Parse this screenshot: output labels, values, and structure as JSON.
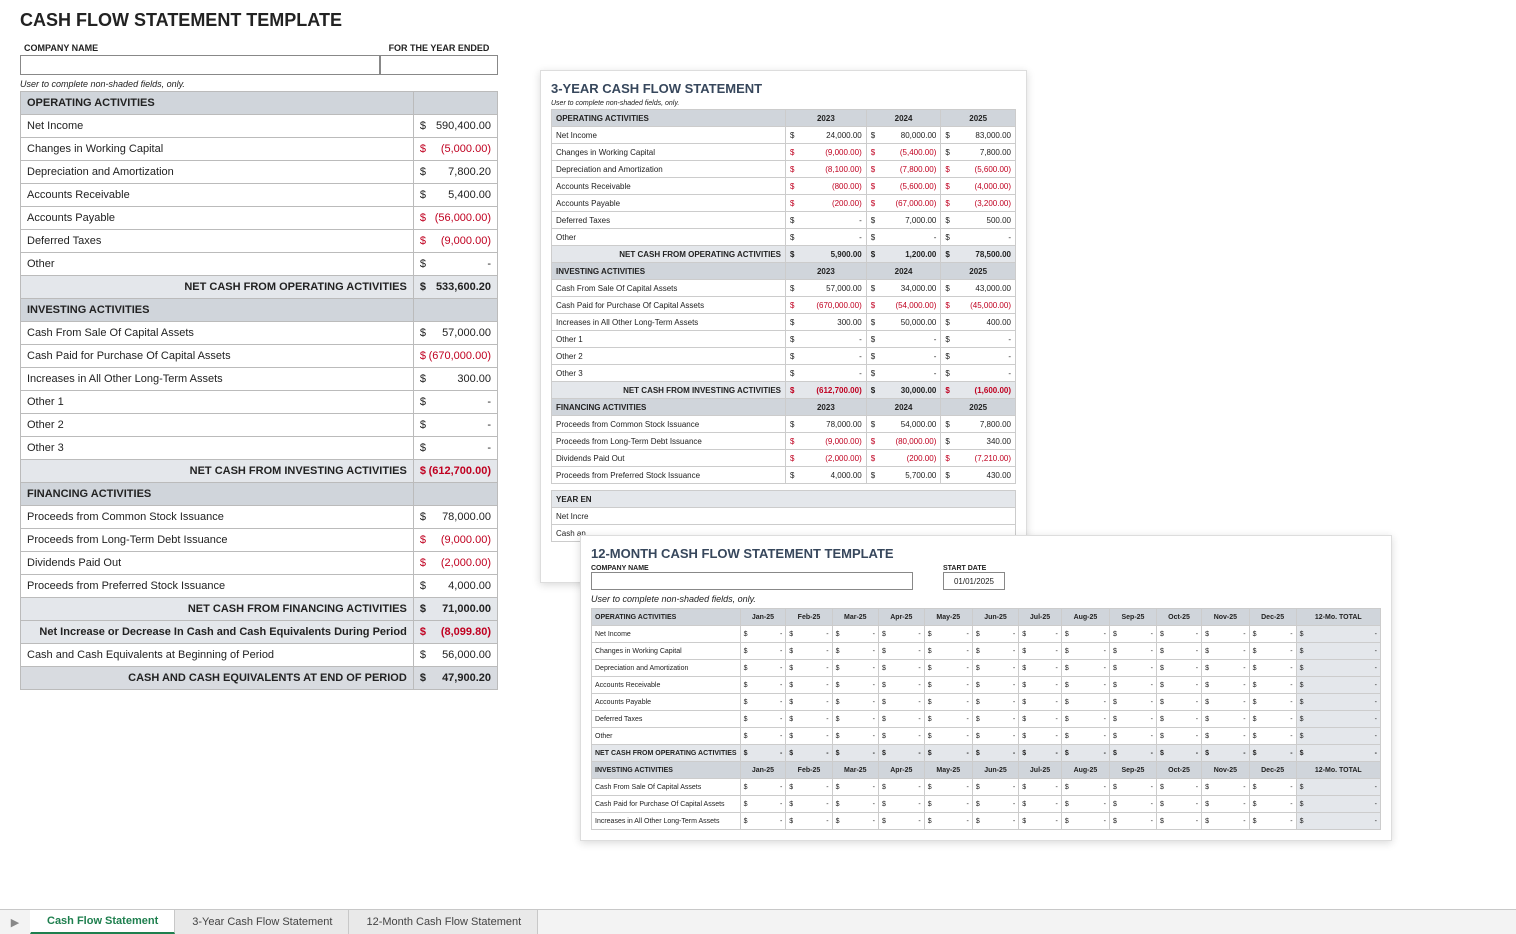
{
  "main": {
    "title": "CASH FLOW STATEMENT TEMPLATE",
    "label_company": "COMPANY NAME",
    "label_year": "FOR THE YEAR ENDED",
    "note": "User to complete non-shaded fields, only.",
    "sec_op": "OPERATING ACTIVITIES",
    "sec_inv": "INVESTING ACTIVITIES",
    "sec_fin": "FINANCING ACTIVITIES",
    "op_rows": [
      {
        "label": "Net Income",
        "val": "590,400.00",
        "neg": false
      },
      {
        "label": "Changes in Working Capital",
        "val": "(5,000.00)",
        "neg": true
      },
      {
        "label": "Depreciation and Amortization",
        "val": "7,800.20",
        "neg": false
      },
      {
        "label": "Accounts Receivable",
        "val": "5,400.00",
        "neg": false
      },
      {
        "label": "Accounts Payable",
        "val": "(56,000.00)",
        "neg": true
      },
      {
        "label": "Deferred Taxes",
        "val": "(9,000.00)",
        "neg": true
      },
      {
        "label": "Other",
        "val": "-",
        "neg": false
      }
    ],
    "op_total_label": "NET CASH FROM OPERATING ACTIVITIES",
    "op_total": "533,600.20",
    "inv_rows": [
      {
        "label": "Cash From Sale Of Capital Assets",
        "val": "57,000.00",
        "neg": false
      },
      {
        "label": "Cash Paid for Purchase Of Capital Assets",
        "val": "(670,000.00)",
        "neg": true
      },
      {
        "label": "Increases in All Other Long-Term Assets",
        "val": "300.00",
        "neg": false
      },
      {
        "label": "Other 1",
        "val": "-",
        "neg": false
      },
      {
        "label": "Other 2",
        "val": "-",
        "neg": false
      },
      {
        "label": "Other 3",
        "val": "-",
        "neg": false
      }
    ],
    "inv_total_label": "NET CASH FROM INVESTING ACTIVITIES",
    "inv_total": "(612,700.00)",
    "fin_rows": [
      {
        "label": "Proceeds from Common Stock Issuance",
        "val": "78,000.00",
        "neg": false
      },
      {
        "label": "Proceeds from Long-Term Debt Issuance",
        "val": "(9,000.00)",
        "neg": true
      },
      {
        "label": "Dividends Paid Out",
        "val": "(2,000.00)",
        "neg": true
      },
      {
        "label": "Proceeds from Preferred Stock Issuance",
        "val": "4,000.00",
        "neg": false
      }
    ],
    "fin_total_label": "NET CASH FROM FINANCING ACTIVITIES",
    "fin_total": "71,000.00",
    "sum_rows": [
      {
        "label": "Net Increase or Decrease In Cash and Cash Equivalents During Period",
        "val": "(8,099.80)",
        "neg": true,
        "cls": "tot"
      },
      {
        "label": "Cash and Cash Equivalents at Beginning of Period",
        "val": "56,000.00",
        "neg": false,
        "cls": ""
      }
    ],
    "grand_label": "CASH AND CASH EQUIVALENTS AT END OF PERIOD",
    "grand": "47,900.20"
  },
  "three": {
    "title": "3-YEAR CASH FLOW STATEMENT",
    "note": "User to complete non-shaded fields, only.",
    "years": [
      "2023",
      "2024",
      "2025"
    ],
    "sec_op": "OPERATING ACTIVITIES",
    "op_rows": [
      {
        "label": "Net Income",
        "v": [
          "24,000.00",
          "80,000.00",
          "83,000.00"
        ],
        "n": [
          false,
          false,
          false
        ]
      },
      {
        "label": "Changes in Working Capital",
        "v": [
          "(9,000.00)",
          "(5,400.00)",
          "7,800.00"
        ],
        "n": [
          true,
          true,
          false
        ]
      },
      {
        "label": "Depreciation and Amortization",
        "v": [
          "(8,100.00)",
          "(7,800.00)",
          "(5,600.00)"
        ],
        "n": [
          true,
          true,
          true
        ]
      },
      {
        "label": "Accounts Receivable",
        "v": [
          "(800.00)",
          "(5,600.00)",
          "(4,000.00)"
        ],
        "n": [
          true,
          true,
          true
        ]
      },
      {
        "label": "Accounts Payable",
        "v": [
          "(200.00)",
          "(67,000.00)",
          "(3,200.00)"
        ],
        "n": [
          true,
          true,
          true
        ]
      },
      {
        "label": "Deferred Taxes",
        "v": [
          "-",
          "7,000.00",
          "500.00"
        ],
        "n": [
          false,
          false,
          false
        ]
      },
      {
        "label": "Other",
        "v": [
          "-",
          "-",
          "-"
        ],
        "n": [
          false,
          false,
          false
        ]
      }
    ],
    "op_total_label": "NET CASH FROM OPERATING ACTIVITIES",
    "op_total": [
      "5,900.00",
      "1,200.00",
      "78,500.00"
    ],
    "op_total_n": [
      false,
      false,
      false
    ],
    "sec_inv": "INVESTING ACTIVITIES",
    "inv_rows": [
      {
        "label": "Cash From Sale Of Capital Assets",
        "v": [
          "57,000.00",
          "34,000.00",
          "43,000.00"
        ],
        "n": [
          false,
          false,
          false
        ]
      },
      {
        "label": "Cash Paid for Purchase Of Capital Assets",
        "v": [
          "(670,000.00)",
          "(54,000.00)",
          "(45,000.00)"
        ],
        "n": [
          true,
          true,
          true
        ]
      },
      {
        "label": "Increases in All Other Long-Term Assets",
        "v": [
          "300.00",
          "50,000.00",
          "400.00"
        ],
        "n": [
          false,
          false,
          false
        ]
      },
      {
        "label": "Other 1",
        "v": [
          "-",
          "-",
          "-"
        ],
        "n": [
          false,
          false,
          false
        ]
      },
      {
        "label": "Other 2",
        "v": [
          "-",
          "-",
          "-"
        ],
        "n": [
          false,
          false,
          false
        ]
      },
      {
        "label": "Other 3",
        "v": [
          "-",
          "-",
          "-"
        ],
        "n": [
          false,
          false,
          false
        ]
      }
    ],
    "inv_total_label": "NET CASH FROM INVESTING ACTIVITIES",
    "inv_total": [
      "(612,700.00)",
      "30,000.00",
      "(1,600.00)"
    ],
    "inv_total_n": [
      true,
      false,
      true
    ],
    "sec_fin": "FINANCING ACTIVITIES",
    "fin_rows": [
      {
        "label": "Proceeds from Common Stock Issuance",
        "v": [
          "78,000.00",
          "54,000.00",
          "7,800.00"
        ],
        "n": [
          false,
          false,
          false
        ]
      },
      {
        "label": "Proceeds from Long-Term Debt Issuance",
        "v": [
          "(9,000.00)",
          "(80,000.00)",
          "340.00"
        ],
        "n": [
          true,
          true,
          false
        ]
      },
      {
        "label": "Dividends Paid Out",
        "v": [
          "(2,000.00)",
          "(200.00)",
          "(7,210.00)"
        ],
        "n": [
          true,
          true,
          true
        ]
      },
      {
        "label": "Proceeds from Preferred Stock Issuance",
        "v": [
          "4,000.00",
          "5,700.00",
          "430.00"
        ],
        "n": [
          false,
          false,
          false
        ]
      }
    ],
    "foot_label_left": "YEAR EN",
    "foot_label_net": "Net Incre",
    "foot_label_cash": "Cash an"
  },
  "twelve": {
    "title": "12-MONTH CASH FLOW STATEMENT TEMPLATE",
    "label_company": "COMPANY NAME",
    "label_start": "START DATE",
    "start_date": "01/01/2025",
    "note": "User to complete non-shaded fields, only.",
    "months": [
      "Jan-25",
      "Feb-25",
      "Mar-25",
      "Apr-25",
      "May-25",
      "Jun-25",
      "Jul-25",
      "Aug-25",
      "Sep-25",
      "Oct-25",
      "Nov-25",
      "Dec-25",
      "12-Mo. TOTAL"
    ],
    "sec_op": "OPERATING ACTIVITIES",
    "op_rows": [
      "Net Income",
      "Changes in Working Capital",
      "Depreciation and Amortization",
      "Accounts Receivable",
      "Accounts Payable",
      "Deferred Taxes",
      "Other"
    ],
    "op_total_label": "NET CASH FROM OPERATING ACTIVITIES",
    "sec_inv": "INVESTING ACTIVITIES",
    "inv_rows": [
      "Cash From Sale Of Capital Assets",
      "Cash Paid for Purchase Of Capital Assets",
      "Increases in All Other Long-Term Assets"
    ]
  },
  "tabs": {
    "t1": "Cash Flow Statement",
    "t2": "3-Year Cash Flow Statement",
    "t3": "12-Month Cash Flow Statement"
  },
  "dollar": "$"
}
